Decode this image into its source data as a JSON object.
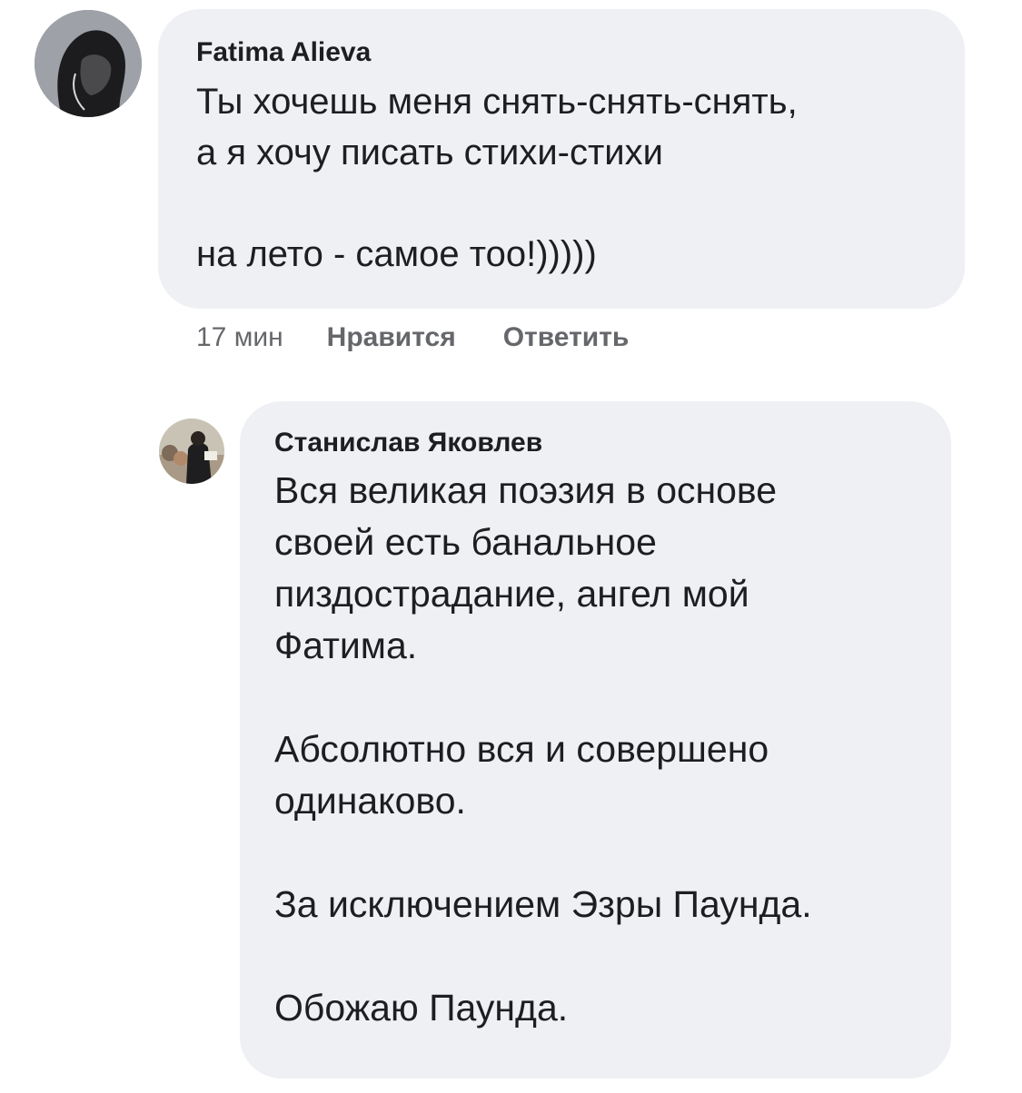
{
  "comments": [
    {
      "author": "Fatima Alieva",
      "paragraphs": [
        "Ты хочешь меня снять-снять-снять,",
        "а я хочу писать стихи-стихи",
        "",
        "на лето - самое тоо!)))))"
      ],
      "time": "17 мин",
      "like_label": "Нравится",
      "reply_label": "Ответить"
    },
    {
      "author": "Станислав Яковлев",
      "paragraphs": [
        "Вся великая поэзия в основе",
        "своей есть банальное",
        "пиздострадание, ангел мой",
        "Фатима.",
        "",
        "Абсолютно вся и совершено",
        "одинаково.",
        "",
        "За исключением Эзры Паунда.",
        "",
        "Обожаю Паунда."
      ]
    }
  ]
}
